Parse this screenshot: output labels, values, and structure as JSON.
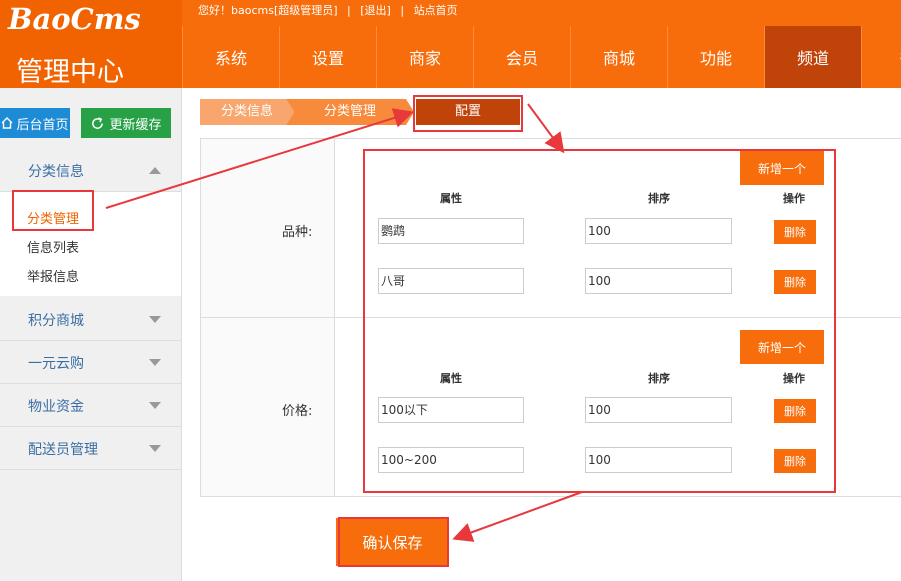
{
  "header": {
    "logo": "BaoCms",
    "subtitle": "管理中心",
    "greeting": "您好！baocms[超级管理员]",
    "logout": "[退出]",
    "site_home": "站点首页",
    "separator": "|",
    "nav": [
      "系统",
      "设置",
      "商家",
      "会员",
      "商城",
      "功能",
      "频道",
      "微"
    ]
  },
  "sidebar": {
    "home_button": "后台首页",
    "cache_button": "更新缓存",
    "groups": [
      {
        "label": "分类信息",
        "items": [
          "分类管理",
          "信息列表",
          "举报信息"
        ]
      },
      {
        "label": "积分商城"
      },
      {
        "label": "一元云购"
      },
      {
        "label": "物业资金"
      },
      {
        "label": "配送员管理"
      }
    ]
  },
  "breadcrumb": [
    "分类信息",
    "分类管理",
    "配置"
  ],
  "form": {
    "headers": {
      "attr": "属性",
      "sort": "排序",
      "action": "操作"
    },
    "add_button": "新增一个",
    "delete_button": "删除",
    "sections": [
      {
        "label": "品种:",
        "rows": [
          {
            "attr": "鹦鹉",
            "sort": "100"
          },
          {
            "attr": "八哥",
            "sort": "100"
          }
        ]
      },
      {
        "label": "价格:",
        "rows": [
          {
            "attr": "100以下",
            "sort": "100"
          },
          {
            "attr": "100~200",
            "sort": "100"
          }
        ]
      }
    ],
    "save_button": "确认保存"
  },
  "colors": {
    "brand": "#f86d0b",
    "annotation": "#e8383b"
  }
}
